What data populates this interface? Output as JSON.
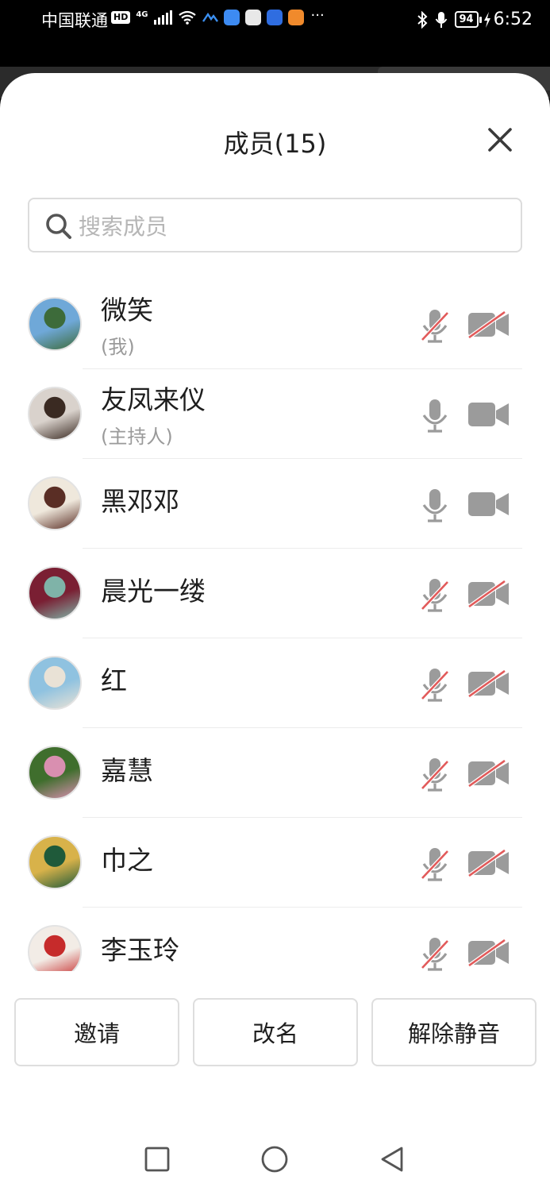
{
  "status_bar": {
    "carrier": "中国联通",
    "hd_badge": "HD",
    "network": "4G",
    "battery": "94",
    "time": "6:52",
    "more": "···",
    "icons": [
      "hd-icon",
      "signal-icon",
      "wifi-icon",
      "app-icon",
      "cloud-app-icon",
      "shield-app-icon",
      "bulb-app-icon",
      "play-app-icon",
      "bluetooth-icon",
      "microphone-icon",
      "battery-icon",
      "charging-icon"
    ]
  },
  "sheet": {
    "title": "成员(15)",
    "close_icon": "close-icon"
  },
  "search": {
    "placeholder": "搜索成员",
    "value": "",
    "icon": "search-icon"
  },
  "members": [
    {
      "name": "微笑",
      "role": "(我)",
      "mic_muted": true,
      "cam_off": true,
      "avatar_colors": [
        "#6fa8d8",
        "#3d6b3a"
      ]
    },
    {
      "name": "友凤来仪",
      "role": "(主持人)",
      "mic_muted": false,
      "cam_off": false,
      "avatar_colors": [
        "#d9d2cc",
        "#3a2a22"
      ]
    },
    {
      "name": "黑邓邓",
      "role": "",
      "mic_muted": false,
      "cam_off": false,
      "avatar_colors": [
        "#efe8dc",
        "#5a2e25"
      ]
    },
    {
      "name": "晨光一缕",
      "role": "",
      "mic_muted": true,
      "cam_off": true,
      "avatar_colors": [
        "#7a1f33",
        "#7fb3a8"
      ]
    },
    {
      "name": "红",
      "role": "",
      "mic_muted": true,
      "cam_off": true,
      "avatar_colors": [
        "#8fc2e0",
        "#e9e2d6"
      ]
    },
    {
      "name": "嘉慧",
      "role": "",
      "mic_muted": true,
      "cam_off": true,
      "avatar_colors": [
        "#3f6e2d",
        "#d98fb0"
      ]
    },
    {
      "name": "巾之",
      "role": "",
      "mic_muted": true,
      "cam_off": true,
      "avatar_colors": [
        "#d8b24a",
        "#1f5a3a"
      ]
    },
    {
      "name": "李玉玲",
      "role": "",
      "mic_muted": true,
      "cam_off": true,
      "avatar_colors": [
        "#f2ece6",
        "#c62b2b"
      ]
    }
  ],
  "actions": {
    "invite": "邀请",
    "rename": "改名",
    "unmute": "解除静音"
  },
  "nav": {
    "recents_icon": "square-recents-icon",
    "home_icon": "circle-home-icon",
    "back_icon": "triangle-back-icon"
  },
  "colors": {
    "muted_slash": "#e25a5a",
    "icon_gray": "#9b9b9b",
    "border": "#dedede"
  }
}
